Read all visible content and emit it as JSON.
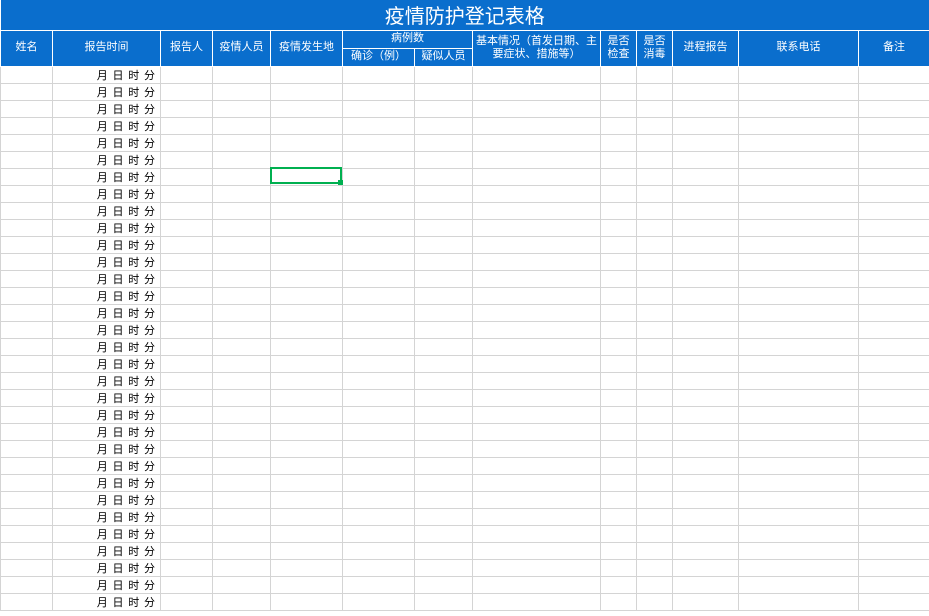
{
  "title": "疫情防护登记表格",
  "columns": {
    "name": "姓名",
    "report_time": "报告时间",
    "reporter": "报告人",
    "epidemic_person": "疫情人员",
    "location": "疫情发生地",
    "cases_group": "病例数",
    "cases_confirmed": "确诊（例）",
    "cases_suspect": "疑似人员",
    "basic_info": "基本情况（首发日期、主要症状、措施等）",
    "checked": "是否检查",
    "disinfected": "是否消毒",
    "progress": "进程报告",
    "phone": "联系电话",
    "note": "备注"
  },
  "row_time_template": "月  日  时  分",
  "row_count": 32,
  "selected_cell": {
    "row_index": 6,
    "col": "location"
  }
}
